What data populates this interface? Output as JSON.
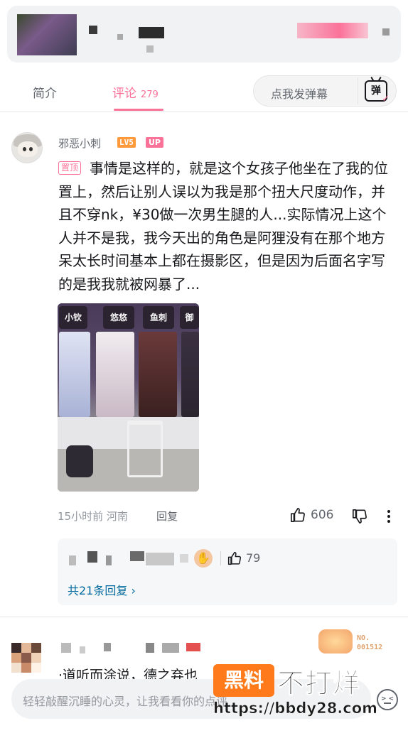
{
  "tabs": {
    "intro_label": "简介",
    "comment_label": "评论",
    "comment_count": "279"
  },
  "danmaku": {
    "placeholder": "点我发弹幕",
    "icon_label": "弹",
    "icon": "danmaku-toggle-icon"
  },
  "comment": {
    "username": "邪恶小刺",
    "level": "LV5",
    "up_badge": "UP",
    "pin_tag": "置顶",
    "text": "事情是这样的，就是这个女孩子他坐在了我的位置上，然后让别人误以为我是那个扭大尺度动作，并且不穿nk，¥30做一次男生腿的人...实际情况上这个人并不是我，我今天出的角色是阿狸没有在那个地方呆太长时间基本上都在摄影区，但是因为后面名字写的是我我就被网暴了...",
    "photo_signs": [
      "小钦",
      "悠悠",
      "鱼刺",
      "御"
    ],
    "time": "15小时前",
    "location": "河南",
    "reply_label": "回复",
    "like_count": "606"
  },
  "reply_preview": {
    "like_count": "79",
    "more_label": "共21条回复"
  },
  "next_comment": {
    "badge_text": "NO.\n001512",
    "text_partial": "·道听而涂说，德之弃也"
  },
  "input": {
    "placeholder": "轻轻敲醒沉睡的心灵，让我看看你的点评"
  },
  "watermark": {
    "box_text": "黑料",
    "text": "不打烊",
    "url": "https://bbdy28.com"
  },
  "colors": {
    "accent": "#fb7299",
    "link": "#00699d",
    "muted": "#9499a0"
  }
}
